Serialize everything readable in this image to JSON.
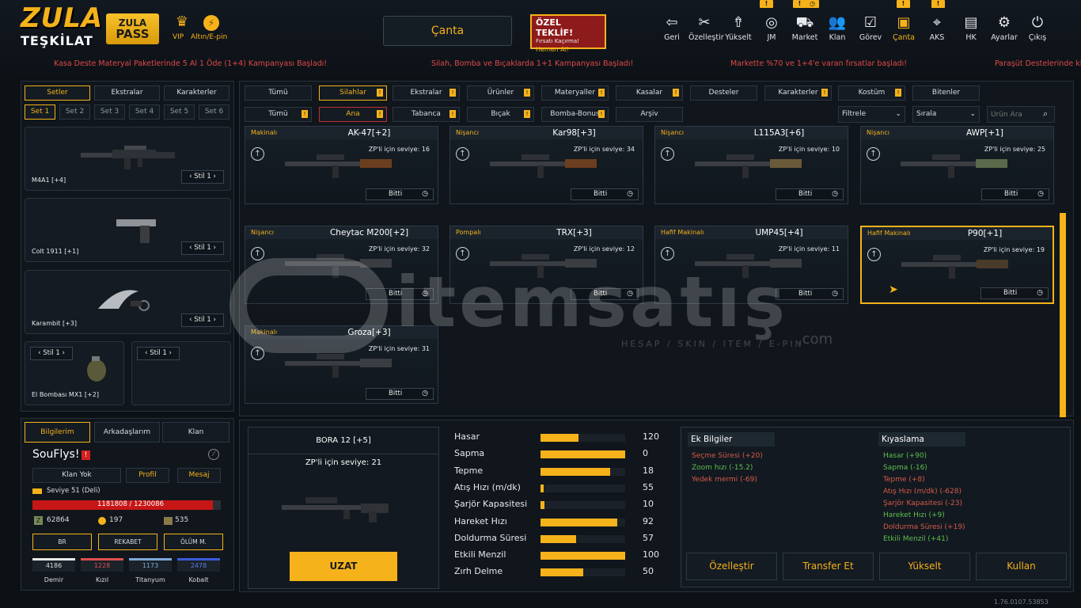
{
  "header": {
    "logo_main": "ZULA",
    "logo_sub": "TEŞKİLAT",
    "pass_line1": "ZULA",
    "pass_line2": "PASS",
    "vip_label": "VIP",
    "altin_label": "Altın/E-pin",
    "center_title": "Çanta",
    "offer_title": "ÖZEL TEKLİF!",
    "offer_sub": "Fırsatı Kaçırma!",
    "offer_cta": "Hemen Al!",
    "nav": [
      {
        "label": "Geri",
        "icon": "back-icon"
      },
      {
        "label": "Özelleştir",
        "icon": "tools-icon"
      },
      {
        "label": "Yükselt",
        "icon": "upgrade-icon"
      },
      {
        "label": "JM",
        "icon": "coins-icon"
      },
      {
        "label": "Market",
        "icon": "cart-icon"
      },
      {
        "label": "Klan",
        "icon": "users-icon"
      },
      {
        "label": "Görev",
        "icon": "checklist-icon"
      },
      {
        "label": "Çanta",
        "icon": "bag-icon"
      },
      {
        "label": "AKS",
        "icon": "crosshair-icon"
      },
      {
        "label": "HK",
        "icon": "wallet-icon"
      },
      {
        "label": "Ayarlar",
        "icon": "gear-icon"
      },
      {
        "label": "Çıkış",
        "icon": "power-icon"
      }
    ],
    "ticker": [
      "Kasa Deste Materyal Paketlerinde 5 Al 1 Öde (1+4) Kampanyası Başladı!",
      "Silah, Bomba ve Bıçaklarda 1+1 Kampanyası Başladı!",
      "Markette %70 ve 1+4'e varan fırsatlar başladı!",
      "Paraşüt Destelerinde kle"
    ]
  },
  "left": {
    "tabs": [
      "Setler",
      "Ekstralar",
      "Karakterler"
    ],
    "sets": [
      "Set 1",
      "Set 2",
      "Set 3",
      "Set 4",
      "Set 5",
      "Set 6"
    ],
    "slots": [
      {
        "name": "M4A1 [+4]",
        "stil": "Stil 1"
      },
      {
        "name": "Colt 1911 [+1]",
        "stil": "Stil 1"
      },
      {
        "name": "Karambit [+3]",
        "stil": "Stil 1"
      },
      {
        "name": "El Bombası MX1 [+2]",
        "stil": "Stil 1"
      },
      {
        "name": "",
        "stil": "Stil 1"
      }
    ]
  },
  "profile": {
    "tabs": [
      "Bilgilerim",
      "Arkadaşlarım",
      "Klan"
    ],
    "name": "SouFlys!",
    "buttons": [
      "Klan Yok",
      "Profil",
      "Mesaj"
    ],
    "level": "Seviye 51 (Deli)",
    "xp": "1181808 / 1230086",
    "xp_fraction": 0.96,
    "cash": "62864",
    "gold": "197",
    "ep": "535",
    "modes": [
      "BR",
      "REKABET",
      "ÖLÜM M."
    ],
    "materials": [
      {
        "value": "4186",
        "label": "Demir",
        "color": "#e8e8e8"
      },
      {
        "value": "1228",
        "label": "Kızıl",
        "color": "#e05050"
      },
      {
        "value": "1173",
        "label": "Titanyum",
        "color": "#7fa8d8"
      },
      {
        "value": "2478",
        "label": "Kobalt",
        "color": "#3a5cd8"
      }
    ]
  },
  "filters": {
    "row1": [
      "Tümü",
      "Silahlar",
      "Ekstralar",
      "Ürünler",
      "Materyaller",
      "Kasalar",
      "Desteler",
      "Karakterler",
      "Kostüm",
      "Bitenler"
    ],
    "row2": [
      "Tümü",
      "Ana",
      "Tabanca",
      "Bıçak",
      "Bomba-Bonus",
      "Arşiv"
    ],
    "filter_label": "Filtrele",
    "sort_label": "Sırala",
    "search_placeholder": "Ürün Ara"
  },
  "items": [
    {
      "category": "Makinalı",
      "name": "AK-47[+2]",
      "level": "ZP'li için seviye: 16",
      "status": "Bitti"
    },
    {
      "category": "Nişancı",
      "name": "Kar98[+3]",
      "level": "ZP'li için seviye: 34",
      "status": "Bitti"
    },
    {
      "category": "Nişancı",
      "name": "L115A3[+6]",
      "level": "ZP'li için seviye: 10",
      "status": "Bitti"
    },
    {
      "category": "Nişancı",
      "name": "AWP[+1]",
      "level": "ZP'li için seviye: 25",
      "status": "Bitti"
    },
    {
      "category": "Nişancı",
      "name": "Cheytac M200[+2]",
      "level": "ZP'li için seviye: 32",
      "status": "Bitti"
    },
    {
      "category": "Pompalı",
      "name": "TRX[+3]",
      "level": "ZP'li için seviye: 12",
      "status": "Bitti"
    },
    {
      "category": "Hafif Makinalı",
      "name": "UMP45[+4]",
      "level": "ZP'li için seviye: 11",
      "status": "Bitti"
    },
    {
      "category": "Hafif Makinalı",
      "name": "P90[+1]",
      "level": "ZP'li için seviye: 19",
      "status": "Bitti"
    },
    {
      "category": "Makinalı",
      "name": "Groza[+3]",
      "level": "ZP'li için seviye: 31",
      "status": "Bitti"
    }
  ],
  "detail": {
    "name": "BORA 12 [+5]",
    "level": "ZP'li için seviye: 21",
    "extend_button": "UZAT",
    "stats": [
      {
        "label": "Hasar",
        "value": "120",
        "fraction": 0.45
      },
      {
        "label": "Sapma",
        "value": "0",
        "fraction": 1.0
      },
      {
        "label": "Tepme",
        "value": "18",
        "fraction": 0.82
      },
      {
        "label": "Atış Hızı (m/dk)",
        "value": "55",
        "fraction": 0.04
      },
      {
        "label": "Şarjör Kapasitesi",
        "value": "10",
        "fraction": 0.05
      },
      {
        "label": "Hareket Hızı",
        "value": "92",
        "fraction": 0.91
      },
      {
        "label": "Doldurma Süresi",
        "value": "57",
        "fraction": 0.42
      },
      {
        "label": "Etkili Menzil",
        "value": "100",
        "fraction": 1.0
      },
      {
        "label": "Zırh Delme",
        "value": "50",
        "fraction": 0.5
      }
    ],
    "extra_title": "Ek Bilgiler",
    "extras": [
      {
        "text": "Seçme Süresi (+20)",
        "color": "#d85a4a"
      },
      {
        "text": "Zoom hızı (-15.2)",
        "color": "#5fbf4f"
      },
      {
        "text": "Yedek mermi (-69)",
        "color": "#d85a4a"
      }
    ],
    "compare_title": "Kıyaslama",
    "compare": [
      {
        "text": "Hasar (+90)",
        "color": "#5fbf4f"
      },
      {
        "text": "Sapma (-16)",
        "color": "#5fbf4f"
      },
      {
        "text": "Tepme (+8)",
        "color": "#d85a4a"
      },
      {
        "text": "Atış Hızı (m/dk) (-628)",
        "color": "#d85a4a"
      },
      {
        "text": "Şarjör Kapasitesi (-23)",
        "color": "#d85a4a"
      },
      {
        "text": "Hareket Hızı (+9)",
        "color": "#5fbf4f"
      },
      {
        "text": "Doldurma Süresi (+19)",
        "color": "#d85a4a"
      },
      {
        "text": "Etkili Menzil (+41)",
        "color": "#5fbf4f"
      }
    ],
    "actions": [
      "Özelleştir",
      "Transfer Et",
      "Yükselt",
      "Kullan"
    ]
  },
  "version": "1.76.0107.53853",
  "watermark": "itemsatış",
  "watermark_sub": "HESAP / SKIN / ITEM / E-PIN",
  "watermark_tld": ".com"
}
